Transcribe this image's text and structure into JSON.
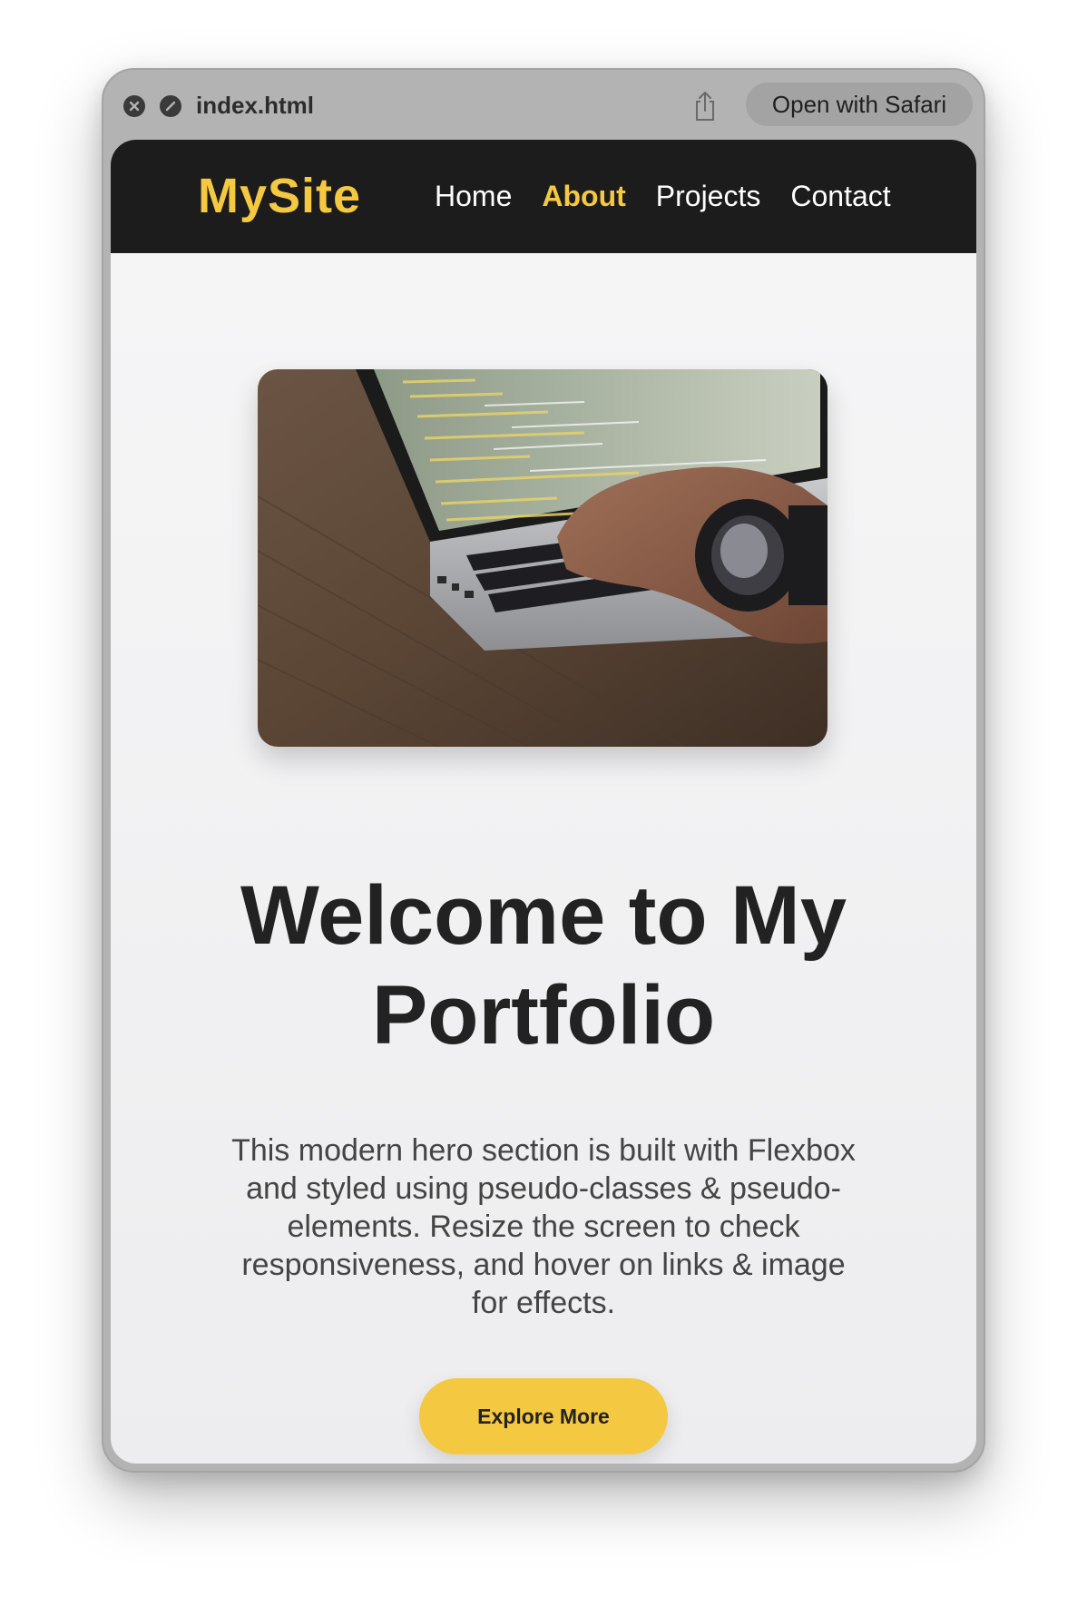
{
  "window": {
    "filename": "index.html",
    "open_with_label": "Open with Safari"
  },
  "navbar": {
    "logo": "MySite",
    "links": [
      {
        "label": "Home",
        "active": false
      },
      {
        "label": "About",
        "active": true
      },
      {
        "label": "Projects",
        "active": false
      },
      {
        "label": "Contact",
        "active": false
      }
    ]
  },
  "hero": {
    "image_description": "hands-typing-on-laptop-with-code",
    "title": "Welcome to My Portfolio",
    "description": "This modern hero section is built with Flexbox and styled using pseudo-classes & pseudo-elements. Resize the screen to check responsiveness, and hover on links & image for effects.",
    "cta_label": "Explore More"
  },
  "colors": {
    "accent": "#f5c842",
    "navbar_bg": "#1c1c1c",
    "heading": "#222222",
    "body_text": "#444444"
  },
  "icons": [
    "close-icon",
    "block-icon",
    "share-icon"
  ]
}
